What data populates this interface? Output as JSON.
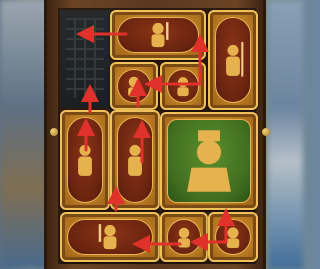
{
  "colors": {
    "frame_wood": "#5a3720",
    "tile_gold": "#c98d2e",
    "tile_red": "#6a2410",
    "general_green": "#3f6e1f",
    "arrow_red": "#e0312a"
  },
  "board": {
    "exit_gate_icon": "portcullis-icon",
    "tiles": [
      {
        "id": "soldier-horizontal-top",
        "figure": "soldier-with-sword-icon"
      },
      {
        "id": "soldier-vertical-top-right",
        "figure": "soldier-with-spear-icon"
      },
      {
        "id": "soldier-small-1",
        "figure": "soldier-icon"
      },
      {
        "id": "soldier-small-2",
        "figure": "soldier-icon"
      },
      {
        "id": "soldier-vertical-left",
        "figure": "soldier-icon"
      },
      {
        "id": "soldier-vertical-center",
        "figure": "soldier-icon"
      },
      {
        "id": "general-big",
        "figure": "general-cao-cao-icon"
      },
      {
        "id": "soldier-horizontal-bottom",
        "figure": "soldier-with-sword-icon"
      },
      {
        "id": "soldier-small-3",
        "figure": "soldier-icon"
      },
      {
        "id": "soldier-small-4",
        "figure": "soldier-icon"
      }
    ],
    "move_arrows_icon": "red-arrow-icon"
  }
}
